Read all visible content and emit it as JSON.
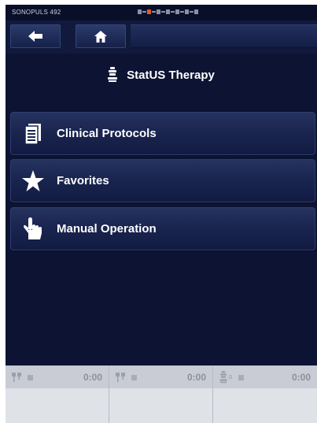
{
  "status_bar": {
    "device_name": "SONOPULS 492"
  },
  "nav": {
    "back_icon": "arrow-left-icon",
    "home_icon": "home-icon"
  },
  "title": {
    "icon": "ultrasound-head-icon",
    "text": "StatUS Therapy"
  },
  "menu": {
    "items": [
      {
        "icon": "document-list-icon",
        "label": "Clinical Protocols"
      },
      {
        "icon": "star-icon",
        "label": "Favorites"
      },
      {
        "icon": "hand-pointer-icon",
        "label": "Manual Operation"
      }
    ]
  },
  "channels": [
    {
      "icon": "electrode-icon",
      "tag": "",
      "time": "0:00"
    },
    {
      "icon": "electrode-icon",
      "tag": "",
      "time": "0:00"
    },
    {
      "icon": "ultrasound-head-icon",
      "tag": "0",
      "time": "0:00"
    }
  ],
  "colors": {
    "background": "#0d1433",
    "accent_channel": "#e05a2b",
    "bottom_panel": "#dfe2e7"
  }
}
